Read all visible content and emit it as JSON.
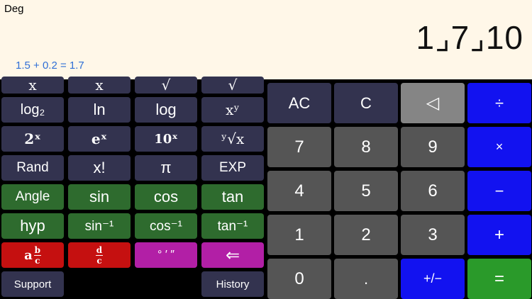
{
  "display": {
    "mode": "Deg",
    "result": "1⌟7⌟10",
    "history_line": "1.5 + 0.2 = 1.7"
  },
  "sci": {
    "row0": [
      "x",
      "x",
      "√",
      "√"
    ],
    "row1": [
      "log₂",
      "ln",
      "log",
      "xʸ"
    ],
    "row2": [
      "2ˣ",
      "eˣ",
      "10ˣ",
      "ʸ√x"
    ],
    "row3": [
      "Rand",
      "x!",
      "π",
      "EXP"
    ],
    "row4": [
      "Angle",
      "sin",
      "cos",
      "tan"
    ],
    "row5": [
      "hyp",
      "sin⁻¹",
      "cos⁻¹",
      "tan⁻¹"
    ],
    "row6": [
      "a",
      "b",
      "c",
      "d",
      "c",
      "° ′ ″",
      "⇐"
    ],
    "row7": [
      "Support",
      "History"
    ]
  },
  "keypad": {
    "row1": [
      "AC",
      "C",
      "◁",
      "÷"
    ],
    "row2": [
      "7",
      "8",
      "9",
      "×"
    ],
    "row3": [
      "4",
      "5",
      "6",
      "−"
    ],
    "row4": [
      "1",
      "2",
      "3",
      "+"
    ],
    "row5": [
      "0",
      ".",
      "+/−",
      "="
    ]
  },
  "colors": {
    "navy": "#33334f",
    "green": "#2e6b2e",
    "red": "#c51010",
    "purple": "#b21fa6",
    "gray": "#555555",
    "light_gray": "#858585",
    "blue": "#1212f0",
    "bright_green": "#2a9a2a"
  }
}
